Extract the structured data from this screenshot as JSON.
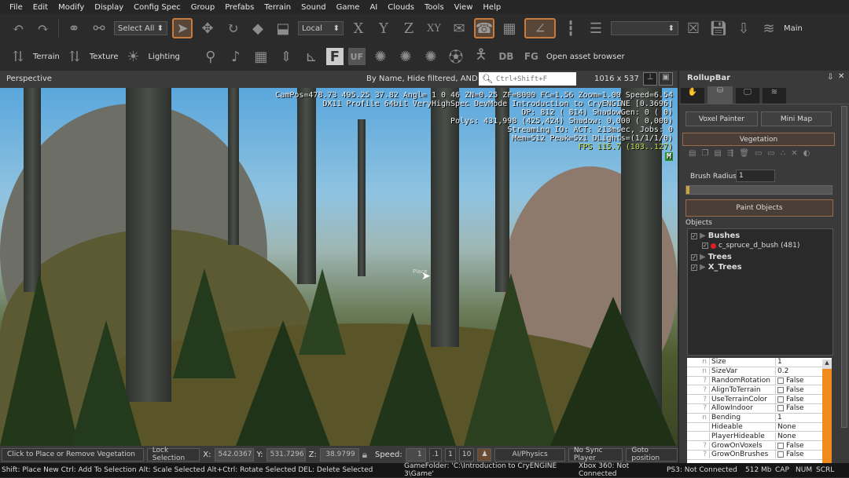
{
  "menu": [
    "File",
    "Edit",
    "Modify",
    "Display",
    "Config Spec",
    "Group",
    "Prefabs",
    "Terrain",
    "Sound",
    "Game",
    "AI",
    "Clouds",
    "Tools",
    "View",
    "Help"
  ],
  "toolbar1": {
    "select_filter": "Select All",
    "coord_system": "Local",
    "axes": [
      "X",
      "Y",
      "Z",
      "XY"
    ],
    "layer": "Main",
    "icons": [
      "undo-icon",
      "redo-icon",
      "link-icon",
      "unlink-icon",
      "select-icon",
      "move-icon",
      "rotate-icon",
      "scale-icon",
      "select-terrain-icon",
      "snap-grid-icon",
      "snap-angle-icon",
      "ruler-icon",
      "layers-icon"
    ]
  },
  "toolbar2": {
    "terrain": "Terrain",
    "texture": "Texture",
    "lighting": "Lighting",
    "F": "F",
    "UF": "UF",
    "DB": "DB",
    "FG": "FG",
    "asset_browser": "Open asset browser"
  },
  "viewport": {
    "title": "Perspective",
    "filter": "By Name, Hide filtered, AND",
    "search_placeholder": "Ctrl+Shift+F",
    "resolution": "1016 x 537",
    "overlay": [
      "CamPos=478.73 495.25 37.82 Angl= 1 0 46 ZN=0.25 ZF=8000 FC=1.56 Zoom=1.00 Speed=6.54",
      "DX11 Profile 64bit VeryHighSpec DevMode Introduction to CryENGINE [0.3696]",
      "DP: 812 ( 814) ShadowGen: 0 ( 0)",
      "Polys: 431,998 (425,424) Shadow: 0,000 ( 0,000)",
      "Streaming IO: ACT: 213msec, Jobs: 0",
      "Mem=512 Peak=521 DLights=(1/1/1/0)"
    ],
    "fps": "FPS 115.7 (103..127)",
    "badge": "M",
    "cursor_label": "Place",
    "fps_color": "#c8e050"
  },
  "vpbar": {
    "hint": "Click to Place or Remove Vegetation",
    "lock": "Lock Selection",
    "x_label": "X:",
    "x": "542.0367",
    "y_label": "Y:",
    "y": "531.7296",
    "z_label": "Z:",
    "z": "38.9799",
    "speed_label": "Speed:",
    "speed": "1",
    "speed_presets": [
      ".1",
      "1",
      "10"
    ],
    "ai_physics": "AI/Physics",
    "sync": "No Sync Player",
    "goto": "Goto position"
  },
  "status": {
    "hint": "Shift: Place New  Ctrl: Add To Selection  Alt: Scale Selected  Alt+Ctrl: Rotate Selected DEL: Delete Selected",
    "game_folder": "GameFolder: 'C:\\Introduction to CryENGINE 3\\Game'",
    "xbox": "Xbox 360: Not Connected",
    "ps3": "PS3: Not Connected",
    "mem": "512 Mb",
    "cap": "CAP",
    "num": "NUM",
    "scrl": "SCRL"
  },
  "rollup": {
    "title": "RollupBar",
    "voxel": "Voxel Painter",
    "minimap": "Mini Map",
    "vegetation": "Vegetation",
    "brush_label": "Brush Radius:",
    "brush_value": "1",
    "brush_fraction": 0.02,
    "paint": "Paint Objects",
    "objects_label": "Objects",
    "tree": [
      {
        "label": "Bushes",
        "level": 0
      },
      {
        "label": "c_spruce_d_bush (481)",
        "level": 1
      },
      {
        "label": "Trees",
        "level": 0
      },
      {
        "label": "X_Trees",
        "level": 0
      }
    ],
    "accent": "#c97a3a"
  },
  "properties": [
    {
      "t": "n",
      "name": "Size",
      "value": "1"
    },
    {
      "t": "n",
      "name": "SizeVar",
      "value": "0.2"
    },
    {
      "t": "?",
      "name": "RandomRotation",
      "value": "False",
      "check": true
    },
    {
      "t": "?",
      "name": "AlignToTerrain",
      "value": "False",
      "check": true
    },
    {
      "t": "?",
      "name": "UseTerrainColor",
      "value": "False",
      "check": true
    },
    {
      "t": "?",
      "name": "AllowIndoor",
      "value": "False",
      "check": true
    },
    {
      "t": "n",
      "name": "Bending",
      "value": "1"
    },
    {
      "t": "",
      "name": "Hideable",
      "value": "None"
    },
    {
      "t": "",
      "name": "PlayerHideable",
      "value": "None"
    },
    {
      "t": "?",
      "name": "GrowOnVoxels",
      "value": "False",
      "check": true
    },
    {
      "t": "?",
      "name": "GrowOnBrushes",
      "value": "False",
      "check": true
    }
  ]
}
